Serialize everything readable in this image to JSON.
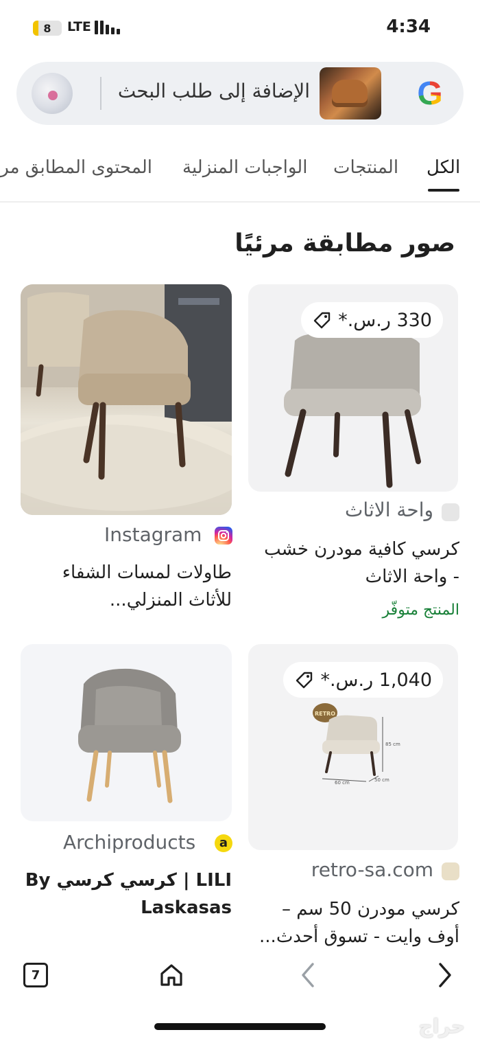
{
  "status_bar": {
    "battery": "8",
    "network": "LTE",
    "time": "4:34"
  },
  "search": {
    "placeholder_text": "الإضافة إلى طلب البحث",
    "logo_letter": "G"
  },
  "tabs": [
    {
      "label": "الكل",
      "active": true
    },
    {
      "label": "المنتجات",
      "active": false
    },
    {
      "label": "الواجبات المنزلية",
      "active": false
    },
    {
      "label": "المحتوى المطابق مرئيًا",
      "active": false
    }
  ],
  "section_title": "صور مطابقة مرئيًا",
  "results": [
    {
      "price": "330 ر.س.*",
      "source": "واحة الاثاث",
      "title_line1": "كرسي كافية مودرن خشب",
      "title_line2": "- واحة الاثاث",
      "availability": "المنتج متوفّر"
    },
    {
      "source": "Instagram",
      "title_line1": "طاولات لمسات الشفاء",
      "title_line2": "للأثاث المنزلي..."
    },
    {
      "price": "1,040 ر.س.*",
      "source": "retro-sa.com",
      "title_line1": "كرسي مودرن 50 سم –",
      "title_line2": "أوف وايت - تسوق أحدث...",
      "image_dims": {
        "height": "85 cm",
        "width": "60 cm",
        "depth": "50 cm"
      },
      "image_badge": "RETRO"
    },
    {
      "source": "Archiproducts",
      "source_letter": "a",
      "title_line1": "LILI | كرسي كرسي By",
      "title_line2": "Laskasas"
    }
  ],
  "bottom_nav": {
    "tabs_count": "7"
  },
  "watermark": "حراج",
  "colors": {
    "availability_green": "#188038",
    "instagram_gradient": "#d6249f",
    "archiproducts_yellow": "#f5d80f"
  }
}
